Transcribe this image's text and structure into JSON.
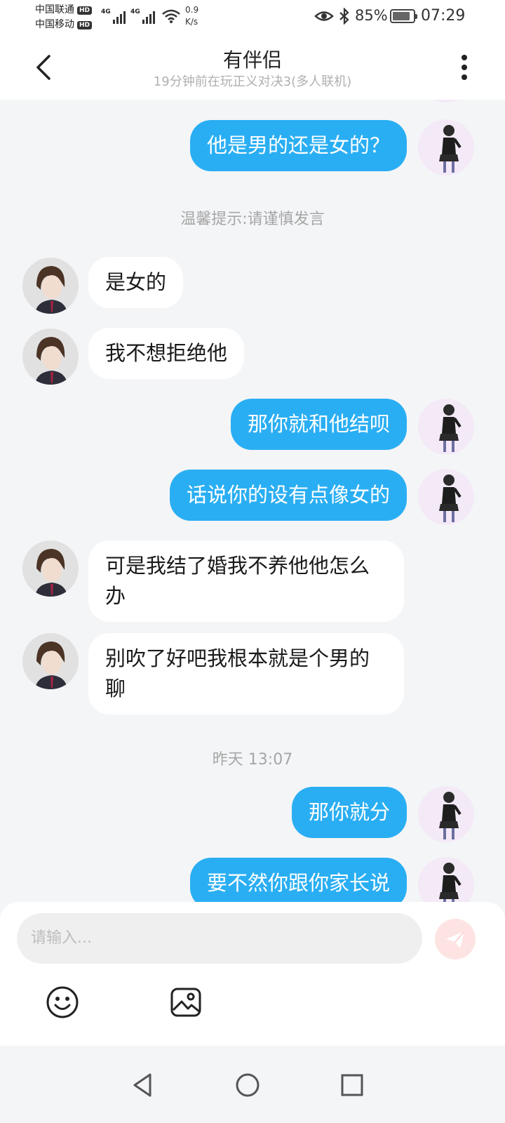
{
  "status_bar": {
    "carrier1": "中国联通",
    "carrier2": "中国移动",
    "hd_badge": "HD",
    "network1": "4G",
    "network2": "4G",
    "net_speed_value": "0.9",
    "net_speed_unit": "K/s",
    "battery": "85%",
    "battery_level": 0.85,
    "time": "07:29"
  },
  "header": {
    "title": "有伴侣",
    "subtitle": "19分钟前在玩正义对决3(多人联机)"
  },
  "messages": [
    {
      "from": "me",
      "text": "他是男的还是女的？"
    },
    {
      "type": "notice",
      "text": "温馨提示:请谨慎发言"
    },
    {
      "from": "them",
      "text": "是女的"
    },
    {
      "from": "them",
      "text": "我不想拒绝他"
    },
    {
      "from": "me",
      "text": "那你就和他结呗"
    },
    {
      "from": "me",
      "text": "话说你的设有点像女的"
    },
    {
      "from": "them",
      "text": "可是我结了婚我不养他他怎么办"
    },
    {
      "from": "them",
      "text": "别吹了好吧我根本就是个男的聊"
    },
    {
      "type": "timestamp",
      "text": "昨天 13:07"
    },
    {
      "from": "me",
      "text": "那你就分"
    },
    {
      "from": "me",
      "text": "要不然你跟你家长说"
    }
  ],
  "input": {
    "placeholder": "请输入..."
  },
  "colors": {
    "my_bubble": "#2aaef3",
    "their_bubble": "#ffffff",
    "background": "#f4f5f7",
    "send_button": "#fde4e2"
  },
  "icons": {
    "back": "chevron-left-icon",
    "more": "more-vertical-icon",
    "send": "paper-plane-icon",
    "emoji": "smiley-icon",
    "image": "image-icon",
    "nav_back": "triangle-back-icon",
    "nav_home": "circle-home-icon",
    "nav_recent": "square-recent-icon"
  }
}
